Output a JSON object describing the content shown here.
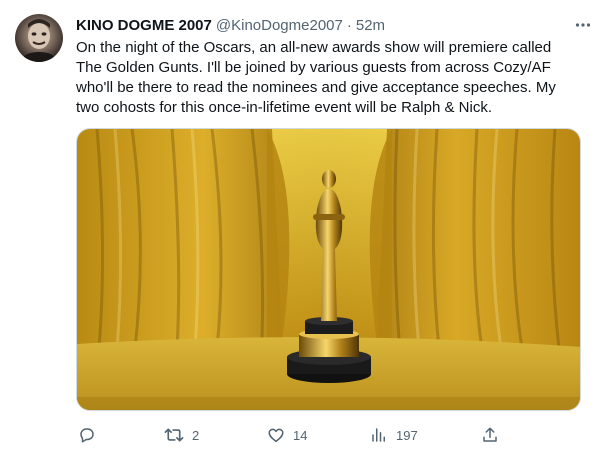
{
  "tweet": {
    "author_name": "KINO DOGME 2007",
    "author_handle": "@KinoDogme2007",
    "separator": "·",
    "time": "52m",
    "text": "On the night of the Oscars, an all-new awards show will premiere called\nThe Golden Gunts. I'll be joined by various guests from across Cozy/AF\nwho'll be there to read the nominees and give acceptance speeches. My\ntwo cohosts for this once-in-lifetime event will be Ralph & Nick.",
    "media_icon": "oscar-statuette-photo"
  },
  "actions": {
    "reply": {
      "icon": "reply-icon",
      "count": ""
    },
    "retweet": {
      "icon": "retweet-icon",
      "count": "2"
    },
    "like": {
      "icon": "heart-icon",
      "count": "14"
    },
    "views": {
      "icon": "views-icon",
      "count": "197"
    },
    "share": {
      "icon": "share-icon",
      "count": ""
    }
  },
  "colors": {
    "text": "#0f1419",
    "muted": "#536471",
    "curtain": "#d4a21a",
    "table": "#c9a326"
  }
}
